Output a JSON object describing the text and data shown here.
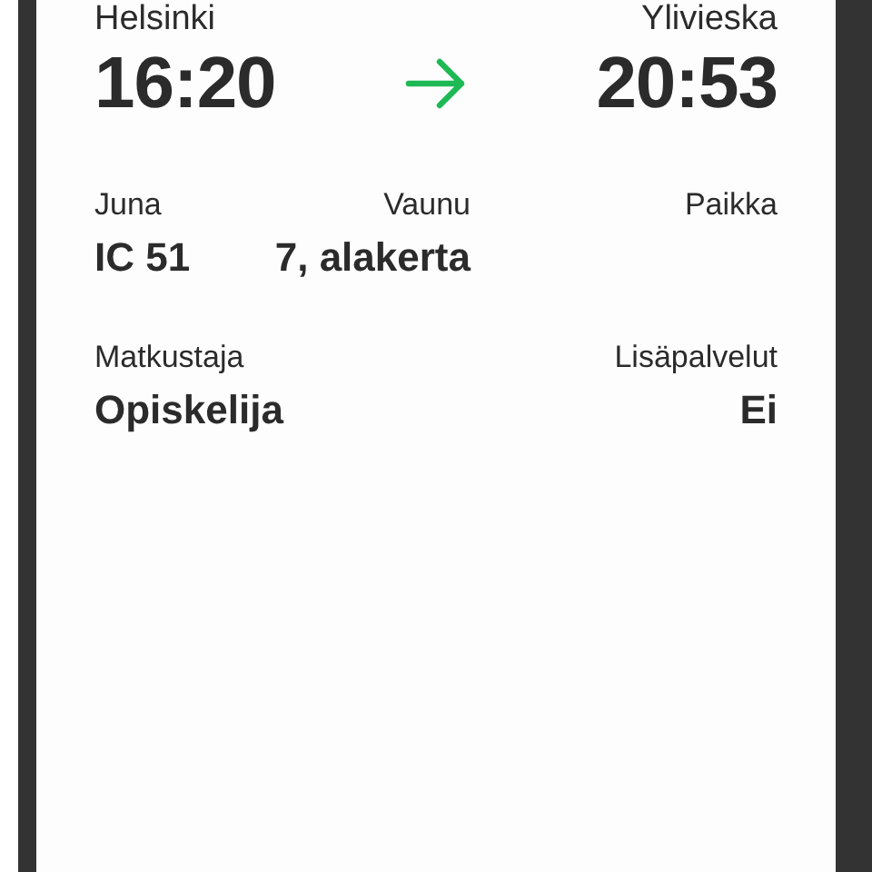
{
  "route": {
    "from": {
      "station": "Helsinki",
      "time": "16:20"
    },
    "to": {
      "station": "Ylivieska",
      "time": "20:53"
    }
  },
  "details": [
    {
      "label": "Juna",
      "value": "IC 51"
    },
    {
      "label": "Vaunu",
      "value": "7, alakerta"
    },
    {
      "label": "Paikka"
    }
  ],
  "extras": [
    {
      "label": "Matkustaja",
      "value": "Opiskelija"
    },
    {
      "label": "Lisäpalvelut",
      "value": "Ei"
    }
  ]
}
